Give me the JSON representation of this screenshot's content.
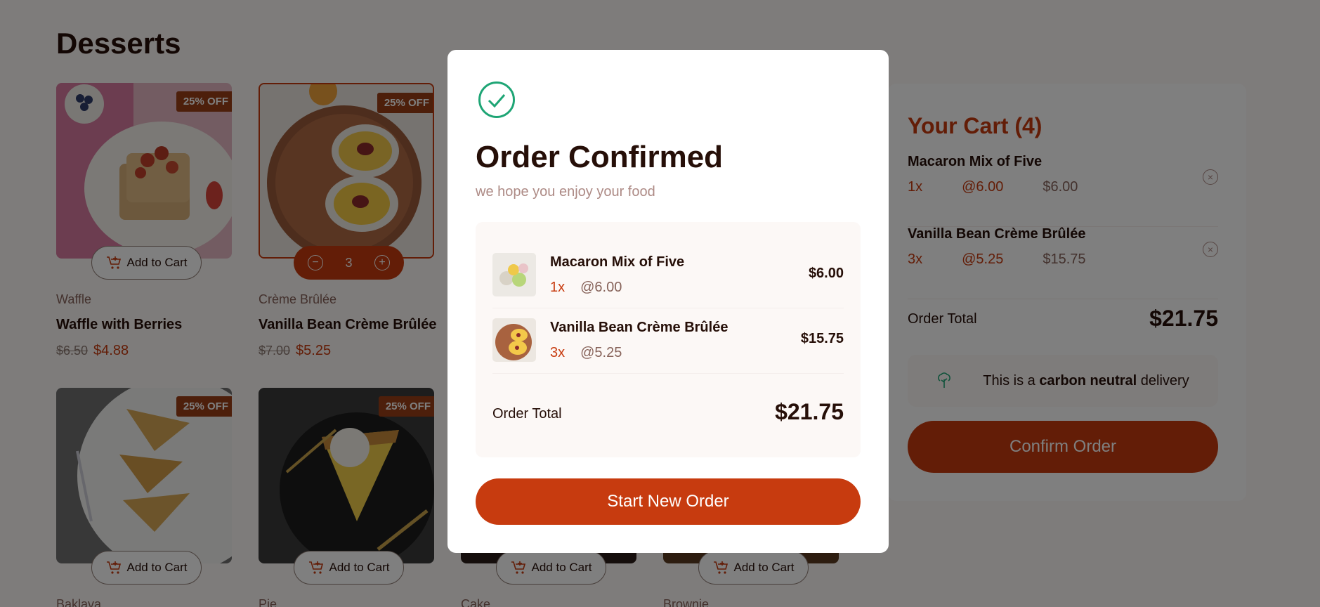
{
  "page": {
    "title": "Desserts"
  },
  "colors": {
    "accent": "#c73b0f",
    "badge": "#9a3e16",
    "success": "#1ea575",
    "overlay": "rgba(0,0,0,0.5)"
  },
  "products": [
    {
      "category": "Waffle",
      "name": "Waffle with Berries",
      "old_price": "$6.50",
      "price": "$4.88",
      "badge": "25% OFF",
      "button": "Add to Cart"
    },
    {
      "category": "Crème Brûlée",
      "name": "Vanilla Bean Crème Brûlée",
      "old_price": "$7.00",
      "price": "$5.25",
      "badge": "25% OFF",
      "quantity": "3"
    },
    {
      "category": "Baklava",
      "badge": "25% OFF",
      "button": "Add to Cart"
    },
    {
      "category": "Pie",
      "badge": "25% OFF",
      "button": "Add to Cart"
    },
    {
      "category": "Cake",
      "button": "Add to Cart"
    },
    {
      "category": "Brownie",
      "button": "Add to Cart"
    }
  ],
  "cart": {
    "title": "Your Cart (4)",
    "items": [
      {
        "name": "Macaron Mix of Five",
        "qty": "1x",
        "unit": "@6.00",
        "total": "$6.00"
      },
      {
        "name": "Vanilla Bean Crème Brûlée",
        "qty": "3x",
        "unit": "@5.25",
        "total": "$15.75"
      }
    ],
    "total_label": "Order Total",
    "total_value": "$21.75",
    "carbon_prefix": "This is a",
    "carbon_bold": "carbon neutral",
    "carbon_suffix": "delivery",
    "confirm_label": "Confirm Order"
  },
  "modal": {
    "icon": "check-circle-icon",
    "title": "Order Confirmed",
    "subtitle": "we hope you enjoy your food",
    "items": [
      {
        "name": "Macaron Mix of Five",
        "qty": "1x",
        "unit": "@6.00",
        "total": "$6.00"
      },
      {
        "name": "Vanilla Bean Crème Brûlée",
        "qty": "3x",
        "unit": "@5.25",
        "total": "$15.75"
      }
    ],
    "total_label": "Order Total",
    "total_value": "$21.75",
    "button_label": "Start New Order"
  }
}
